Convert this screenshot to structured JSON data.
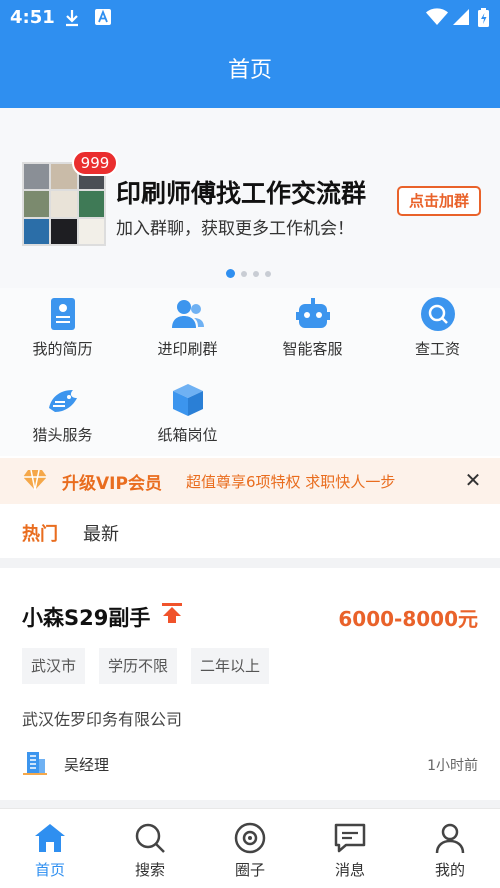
{
  "status_bar": {
    "time": "4:51"
  },
  "header": {
    "title": "首页"
  },
  "banner": {
    "badge": "999",
    "title": "印刷师傅找工作交流群",
    "subtitle": "加入群聊，获取更多工作机会！",
    "join_label": "点击加群"
  },
  "grid": [
    {
      "label": "我的简历",
      "icon": "resume-icon"
    },
    {
      "label": "进印刷群",
      "icon": "group-icon"
    },
    {
      "label": "智能客服",
      "icon": "robot-icon"
    },
    {
      "label": "查工资",
      "icon": "search-salary-icon"
    },
    {
      "label": "猎头服务",
      "icon": "headhunter-icon"
    },
    {
      "label": "纸箱岗位",
      "icon": "box-icon"
    }
  ],
  "vip": {
    "title": "升级VIP会员",
    "description": "超值尊享6项特权 求职快人一步",
    "close": "✕"
  },
  "tabs": {
    "hot": "热门",
    "latest": "最新"
  },
  "job": {
    "title": "小森S29副手",
    "salary": "6000-8000元",
    "tags": [
      "武汉市",
      "学历不限",
      "二年以上"
    ],
    "company": "武汉佐罗印务有限公司",
    "recruiter": "吴经理",
    "posted": "1小时前"
  },
  "nav": [
    {
      "label": "首页",
      "icon": "home-icon"
    },
    {
      "label": "搜索",
      "icon": "search-icon"
    },
    {
      "label": "圈子",
      "icon": "circle-icon"
    },
    {
      "label": "消息",
      "icon": "message-icon"
    },
    {
      "label": "我的",
      "icon": "profile-icon"
    }
  ],
  "colors": {
    "primary": "#2f8ff0",
    "accent": "#e96d1f",
    "badge": "#ea2f2f"
  }
}
